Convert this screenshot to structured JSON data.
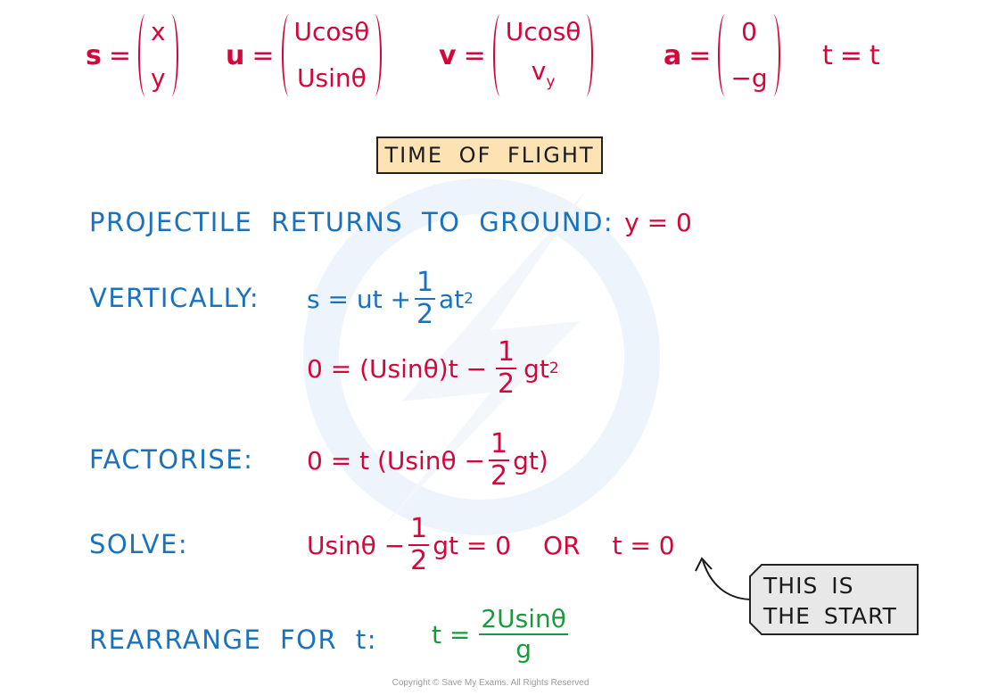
{
  "colors": {
    "definitions": "#d4063a",
    "labels": "#1a72bd",
    "result": "#1a9a3c",
    "title_box_fill": "#fde3b4",
    "tag_fill": "#e8e8e8"
  },
  "vectors": [
    {
      "name": "s",
      "top": "x",
      "bottom": "y"
    },
    {
      "name": "u",
      "top": "Ucosθ",
      "bottom": "Usinθ"
    },
    {
      "name": "v",
      "top": "Ucosθ",
      "bottom_main": "v",
      "bottom_sub": "y"
    },
    {
      "name": "a",
      "top": "0",
      "bottom": "−g"
    },
    {
      "name": "t",
      "value": "t"
    }
  ],
  "equals": "=",
  "title": "TIME OF FLIGHT",
  "steps": {
    "ground": {
      "label": "PROJECTILE RETURNS TO GROUND:",
      "math": "y = 0"
    },
    "vertically": {
      "label": "VERTICALLY:",
      "line1": {
        "lhs": "s = ut +",
        "frac_num": "1",
        "frac_den": "2",
        "after": "at",
        "sup": "2"
      },
      "line2": {
        "lhs": "0 = (Usinθ)t −",
        "frac_num": "1",
        "frac_den": "2",
        "after": "gt",
        "sup": "2"
      }
    },
    "factorise": {
      "label": "FACTORISE:",
      "lhs": "0 = t (Usinθ −",
      "frac_num": "1",
      "frac_den": "2",
      "after": "gt)"
    },
    "solve": {
      "label": "SOLVE:",
      "lhs": "Usinθ −",
      "frac_num": "1",
      "frac_den": "2",
      "after": "gt = 0",
      "or": "OR",
      "alt": "t = 0"
    },
    "rearrange": {
      "label": "REARRANGE FOR t:",
      "lhs": "t =",
      "frac_num": "2Usinθ",
      "frac_den": "g"
    }
  },
  "tag": {
    "line1": "THIS IS",
    "line2": "THE START"
  },
  "copyright": "Copyright © Save My Exams. All Rights Reserved"
}
